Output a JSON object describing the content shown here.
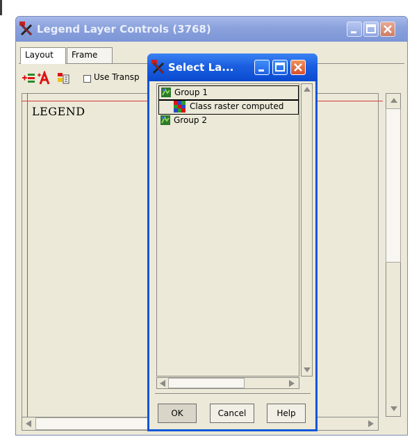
{
  "main_window": {
    "title": "Legend Layer Controls (3768)",
    "tabs": [
      {
        "label": "Layout"
      },
      {
        "label": "Frame"
      }
    ],
    "toolbar": {
      "transparency_label": "Use Transp"
    },
    "canvas": {
      "legend_title": "LEGEND"
    }
  },
  "dialog": {
    "title": "Select La...",
    "items": [
      {
        "label": "Group 1",
        "icon": "group-layer-icon"
      },
      {
        "label": "Class raster computed",
        "icon": "class-raster-icon"
      },
      {
        "label": "Group 2",
        "icon": "group-layer-icon"
      }
    ],
    "buttons": {
      "ok": "OK",
      "cancel": "Cancel",
      "help": "Help"
    }
  },
  "colors": {
    "inactive_title": "#8aa1dc",
    "active_title": "#1b5fe0",
    "window_face": "#ece9d8",
    "guide_line": "#d53b3b"
  }
}
